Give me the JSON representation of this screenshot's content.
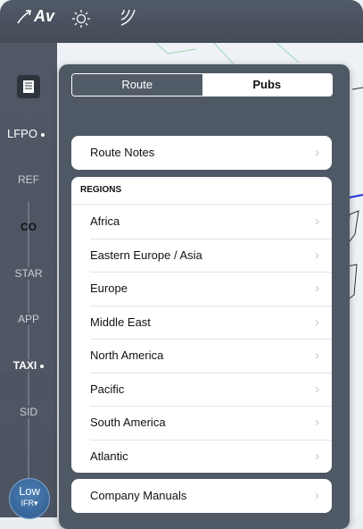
{
  "toolbar": {
    "av_label": "Av",
    "av_icon": "flight-path-icon",
    "sun_icon": "brightness-icon",
    "weather_icon": "weather-radar-icon"
  },
  "sidebar": {
    "doc_icon": "document-icon",
    "airport": "LFPO",
    "items": [
      {
        "label": "REF"
      },
      {
        "label": "CO"
      },
      {
        "label": "STAR"
      },
      {
        "label": "APP"
      },
      {
        "label": "TAXI"
      },
      {
        "label": "SID"
      }
    ],
    "chart_mode": {
      "line1": "Low",
      "line2": "IFR"
    }
  },
  "panel": {
    "tabs": [
      {
        "label": "Route",
        "selected": true
      },
      {
        "label": "Pubs",
        "selected": false
      }
    ],
    "route_notes": "Route Notes",
    "regions_header": "REGIONS",
    "regions": [
      {
        "label": "Africa"
      },
      {
        "label": "Eastern Europe / Asia"
      },
      {
        "label": "Europe"
      },
      {
        "label": "Middle East"
      },
      {
        "label": "North America",
        "marked": true
      },
      {
        "label": "Pacific"
      },
      {
        "label": "South America"
      },
      {
        "label": "Atlantic"
      }
    ],
    "company_manuals": "Company Manuals"
  },
  "colors": {
    "marker": "#e12bd1",
    "toolbar": "#4a525e",
    "route_line": "#1f2ee0"
  }
}
